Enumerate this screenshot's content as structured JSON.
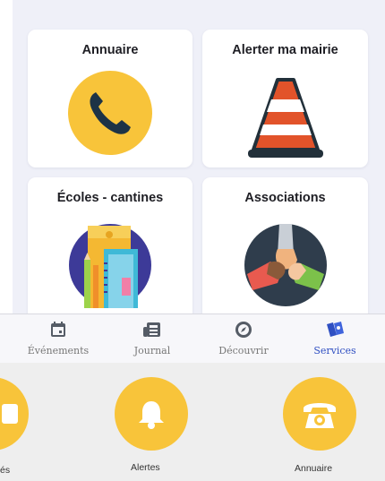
{
  "cards": [
    {
      "title": "Annuaire",
      "icon": "phone-icon"
    },
    {
      "title": "Alerter ma mairie",
      "icon": "traffic-cone-icon"
    },
    {
      "title": "Écoles - cantines",
      "icon": "school-supplies-icon"
    },
    {
      "title": "Associations",
      "icon": "joined-hands-icon"
    }
  ],
  "nav": {
    "items": [
      {
        "label": "Événements",
        "icon": "calendar-icon",
        "active": false
      },
      {
        "label": "Journal",
        "icon": "newspaper-icon",
        "active": false
      },
      {
        "label": "Découvrir",
        "icon": "compass-icon",
        "active": false
      },
      {
        "label": "Services",
        "icon": "services-icon",
        "active": true
      }
    ]
  },
  "strip": {
    "items": [
      {
        "label": "és",
        "icon": "partial-icon"
      },
      {
        "label": "Alertes",
        "icon": "bell-icon"
      },
      {
        "label": "Annuaire",
        "icon": "telephone-icon"
      }
    ]
  },
  "colors": {
    "accent_yellow": "#f8c43a",
    "active_blue": "#2f4fc2",
    "background": "#eff0f8"
  }
}
